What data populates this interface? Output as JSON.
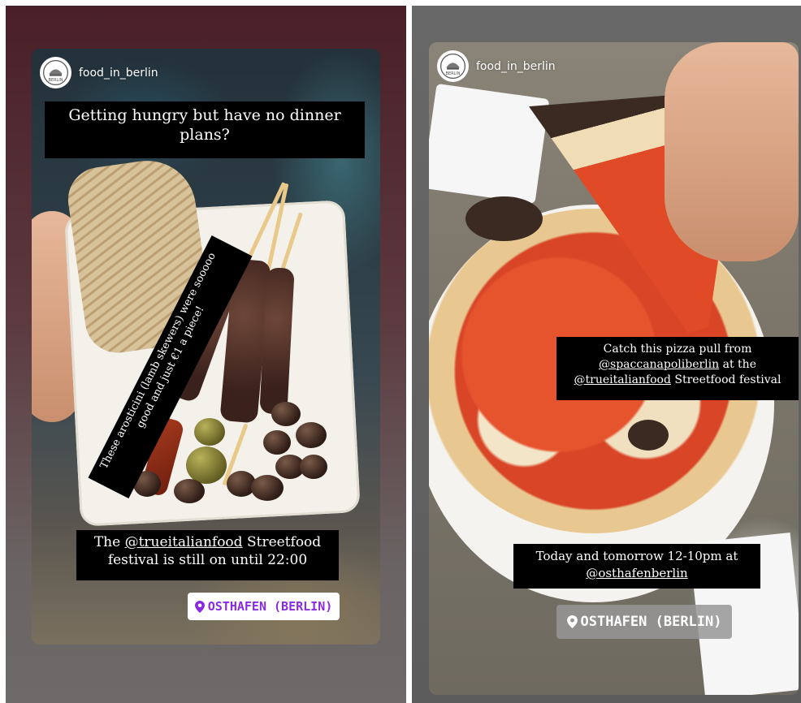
{
  "left_story": {
    "username": "food_in_berlin",
    "avatar_icon": "restaurant-logo-icon",
    "caption_top": "Getting hungry but have no dinner plans?",
    "caption_diagonal": "These arosticini (lamb skewers) were sooooo good and just €1 a piece!",
    "caption_bottom_prefix": "The ",
    "caption_bottom_link": "@trueitalianfood",
    "caption_bottom_suffix": " Streetfood festival is still on until 22:00",
    "location": "OSTHAFEN (BERLIN)",
    "location_icon": "location-pin-icon",
    "location_color": "#8a2be2"
  },
  "right_story": {
    "username": "food_in_berlin",
    "avatar_icon": "restaurant-logo-icon",
    "caption_mid_line1": "Catch this pizza pull from",
    "caption_mid_link1": "@spaccanapoliberlin",
    "caption_mid_line2_suffix": " at the",
    "caption_mid_link2": "@trueitalianfood",
    "caption_mid_line3_suffix": " Streetfood festival",
    "caption_bottom_line1": "Today and tomorrow 12-10pm at",
    "caption_bottom_link": "@osthafenberlin",
    "location": "OSTHAFEN (BERLIN)",
    "location_icon": "location-pin-icon"
  }
}
